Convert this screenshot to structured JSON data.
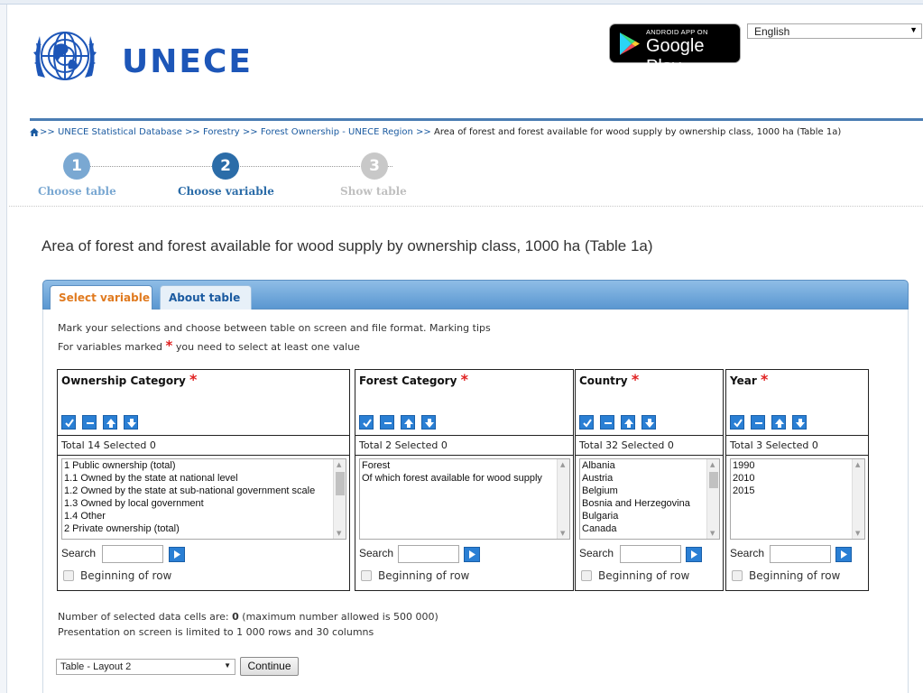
{
  "header": {
    "logo_text": "UNECE",
    "google_play": {
      "small": "ANDROID APP ON",
      "big": "Google Play"
    },
    "language": "English"
  },
  "breadcrumb": {
    "items": [
      "UNECE Statistical Database",
      "Forestry",
      "Forest Ownership - UNECE Region"
    ],
    "current": "Area of forest and forest available for wood supply by ownership class, 1000 ha (Table 1a)",
    "separator": ">>"
  },
  "steps": [
    {
      "num": "1",
      "label": "Choose table"
    },
    {
      "num": "2",
      "label": "Choose variable"
    },
    {
      "num": "3",
      "label": "Show table"
    }
  ],
  "page_title": "Area of forest and forest available for wood supply by ownership class, 1000 ha (Table 1a)",
  "tabs": [
    {
      "label": "Select variable"
    },
    {
      "label": "About table"
    }
  ],
  "instructions": {
    "line1": "Mark your selections and choose between table on screen and file format. Marking tips",
    "line2_prefix": "For variables marked",
    "line2_suffix": "you need to select at least one value",
    "star": "*"
  },
  "variables": [
    {
      "title": "Ownership Category",
      "total": "Total 14 Selected 0",
      "options": [
        "1 Public ownership (total)",
        "1.1 Owned by the state at national level",
        "1.2 Owned by the state at sub-national government scale",
        "1.3 Owned by local government",
        "1.4 Other",
        "2 Private ownership (total)"
      ]
    },
    {
      "title": "Forest Category",
      "total": "Total 2 Selected 0",
      "options": [
        "Forest",
        "Of which forest available for wood supply"
      ]
    },
    {
      "title": "Country",
      "total": "Total 32 Selected 0",
      "options": [
        "Albania",
        "Austria",
        "Belgium",
        "Bosnia and Herzegovina",
        "Bulgaria",
        "Canada"
      ]
    },
    {
      "title": "Year",
      "total": "Total 3 Selected 0",
      "options": [
        "1990",
        "2010",
        "2015"
      ]
    }
  ],
  "search_label": "Search",
  "beginning_label": "Beginning of row",
  "info": {
    "line1_prefix": "Number of selected data cells are:",
    "count": "0",
    "line1_suffix": "(maximum number allowed is 500 000)",
    "line2": "Presentation on screen is limited to 1 000 rows and 30 columns"
  },
  "layout_select": "Table - Layout 2",
  "continue_label": "Continue",
  "colors": {
    "brand": "#1d56b8",
    "tab_active": "#e07a1f",
    "star": "#e02020",
    "icon_btn": "#2a7fd4"
  }
}
